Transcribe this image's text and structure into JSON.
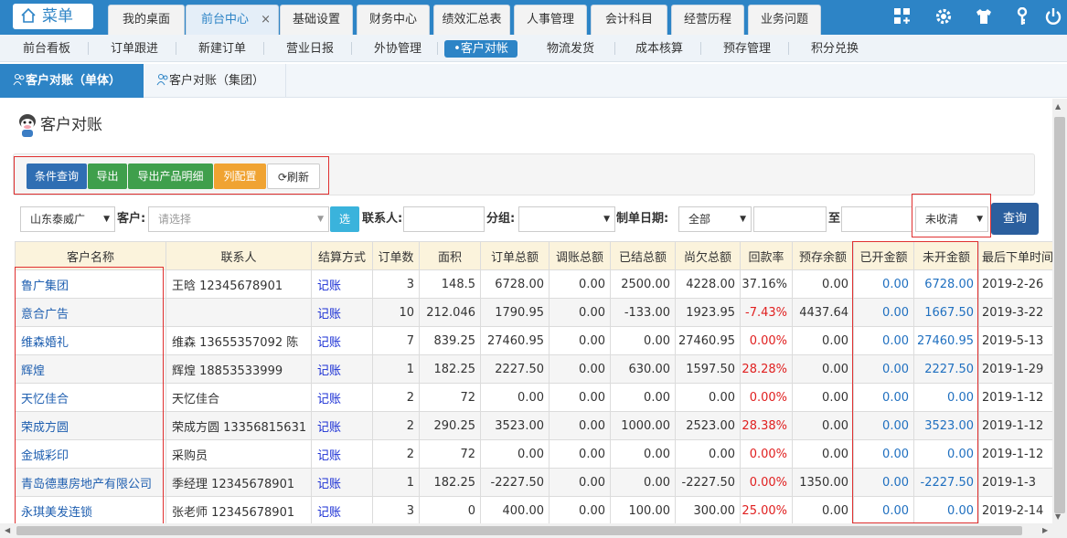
{
  "top": {
    "menu_label": "菜单",
    "tabs": [
      {
        "label": "我的桌面"
      },
      {
        "label": "前台中心",
        "active": true,
        "close": "×"
      },
      {
        "label": "基础设置"
      },
      {
        "label": "财务中心"
      },
      {
        "label": "绩效汇总表"
      },
      {
        "label": "人事管理"
      },
      {
        "label": "会计科目"
      },
      {
        "label": "经营历程"
      },
      {
        "label": "业务问题"
      }
    ],
    "icons": [
      "grid-icon",
      "gear-icon",
      "shirt-icon",
      "key-icon",
      "power-icon"
    ]
  },
  "sub_tabs": [
    "前台看板",
    "订单跟进",
    "新建订单",
    "营业日报",
    "外协管理",
    "•客户对帐",
    "物流发货",
    "成本核算",
    "预存管理",
    "积分兑换"
  ],
  "sub_active": 5,
  "page_tabs": [
    {
      "label": "客户对账（单体）",
      "active": true
    },
    {
      "label": "客户对账（集团）",
      "active": false
    }
  ],
  "page_title": "客户对账",
  "toolbar": {
    "query": "条件查询",
    "export": "导出",
    "export_detail": "导出产品明细",
    "columns": "列配置",
    "refresh": "刷新"
  },
  "colors": {
    "query": "#2f6eb3",
    "export": "#3f9f4c",
    "columns": "#f0a332",
    "refresh": "#ffffff",
    "highlight": "#e03030"
  },
  "filters": {
    "region": "山东泰威广",
    "customer_label": "客户:",
    "customer_placeholder": "请选择",
    "pick_button": "选",
    "contact_label": "联系人:",
    "group_label": "分组:",
    "date_label": "制单日期:",
    "date_range": "全部",
    "to_label": "至",
    "status": "未收清",
    "search_button": "查询"
  },
  "table": {
    "headers": [
      "客户名称",
      "联系人",
      "结算方式",
      "订单数",
      "面积",
      "订单总额",
      "调账总额",
      "已结总额",
      "尚欠总额",
      "回款率",
      "预存余额",
      "已开金额",
      "未开金额",
      "最后下单时间"
    ],
    "rows": [
      [
        "鲁广集团",
        "王晗 12345678901",
        "记账",
        "3",
        "148.5",
        "6728.00",
        "0.00",
        "2500.00",
        "4228.00",
        "37.16%",
        "0.00",
        "0.00",
        "6728.00",
        "2019-2-26"
      ],
      [
        "意合广告",
        "",
        "记账",
        "10",
        "212.046",
        "1790.95",
        "0.00",
        "-133.00",
        "1923.95",
        "-7.43%",
        "4437.64",
        "0.00",
        "1667.50",
        "2019-3-22"
      ],
      [
        "维森婚礼",
        "维森 13655357092 陈",
        "记账",
        "7",
        "839.25",
        "27460.95",
        "0.00",
        "0.00",
        "27460.95",
        "0.00%",
        "0.00",
        "0.00",
        "27460.95",
        "2019-5-13"
      ],
      [
        "辉煌",
        "辉煌 18853533999",
        "记账",
        "1",
        "182.25",
        "2227.50",
        "0.00",
        "630.00",
        "1597.50",
        "28.28%",
        "0.00",
        "0.00",
        "2227.50",
        "2019-1-29"
      ],
      [
        "天忆佳合",
        "天忆佳合",
        "记账",
        "2",
        "72",
        "0.00",
        "0.00",
        "0.00",
        "0.00",
        "0.00%",
        "0.00",
        "0.00",
        "0.00",
        "2019-1-12"
      ],
      [
        "荣成方圆",
        "荣成方圆 13356815631",
        "记账",
        "2",
        "290.25",
        "3523.00",
        "0.00",
        "1000.00",
        "2523.00",
        "28.38%",
        "0.00",
        "0.00",
        "3523.00",
        "2019-1-12"
      ],
      [
        "金城彩印",
        "采购员",
        "记账",
        "2",
        "72",
        "0.00",
        "0.00",
        "0.00",
        "0.00",
        "0.00%",
        "0.00",
        "0.00",
        "0.00",
        "2019-1-12"
      ],
      [
        "青岛德惠房地产有限公司",
        "季经理 12345678901",
        "记账",
        "1",
        "182.25",
        "-2227.50",
        "0.00",
        "0.00",
        "-2227.50",
        "0.00%",
        "1350.00",
        "0.00",
        "-2227.50",
        "2019-1-3"
      ],
      [
        "永琪美发连锁",
        "张老师 12345678901",
        "记账",
        "3",
        "0",
        "400.00",
        "0.00",
        "100.00",
        "300.00",
        "25.00%",
        "0.00",
        "0.00",
        "0.00",
        "2019-2-14"
      ]
    ]
  }
}
